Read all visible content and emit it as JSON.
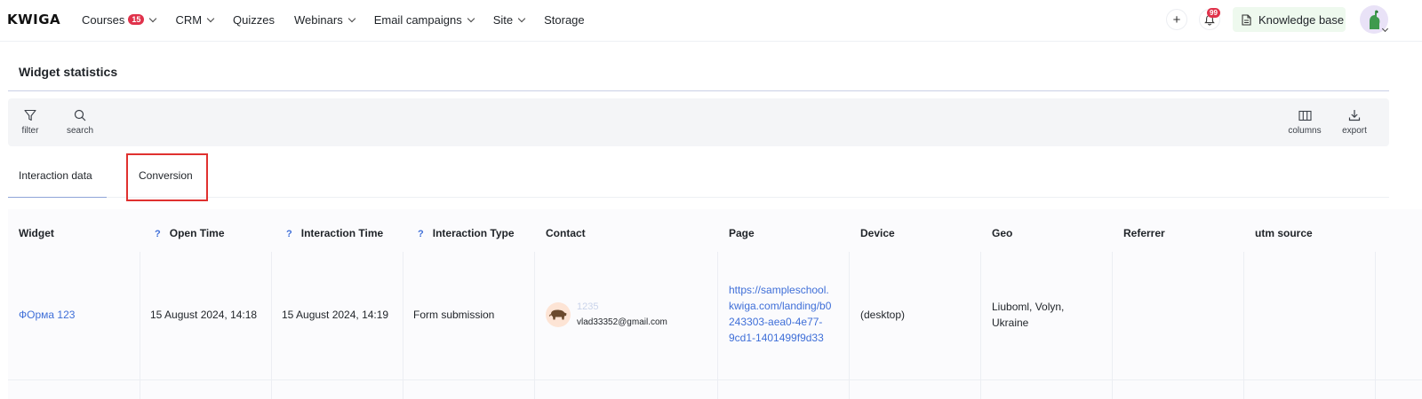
{
  "app": {
    "logo": "KWIGA"
  },
  "nav": {
    "items": [
      {
        "label": "Courses",
        "badge": "15",
        "has_dropdown": true
      },
      {
        "label": "CRM",
        "has_dropdown": true
      },
      {
        "label": "Quizzes",
        "has_dropdown": false
      },
      {
        "label": "Webinars",
        "has_dropdown": true
      },
      {
        "label": "Email campaigns",
        "has_dropdown": true
      },
      {
        "label": "Site",
        "has_dropdown": true
      },
      {
        "label": "Storage",
        "has_dropdown": false
      }
    ],
    "plus_label": "+",
    "notifications_count": "99",
    "knowledge_base_label": "Knowledge base"
  },
  "page": {
    "title": "Widget statistics"
  },
  "toolbar": {
    "filter_label": "filter",
    "search_label": "search",
    "columns_label": "columns",
    "export_label": "export"
  },
  "tabs": [
    {
      "label": "Interaction data",
      "active": true
    },
    {
      "label": "Conversion",
      "active": false
    }
  ],
  "table": {
    "columns": [
      {
        "label": "Widget",
        "help": false
      },
      {
        "label": "Open Time",
        "help": true
      },
      {
        "label": "Interaction Time",
        "help": true
      },
      {
        "label": "Interaction Type",
        "help": true
      },
      {
        "label": "Contact",
        "help": false
      },
      {
        "label": "Page",
        "help": false
      },
      {
        "label": "Device",
        "help": false
      },
      {
        "label": "Geo",
        "help": false
      },
      {
        "label": "Referrer",
        "help": false
      },
      {
        "label": "utm source",
        "help": false
      }
    ],
    "help_mark": "?",
    "rows": [
      {
        "widget": "ФОрма 123",
        "open_time": "15 August 2024, 14:18",
        "interaction_time": "15 August 2024, 14:19",
        "interaction_type": "Form submission",
        "contact_name": "1235",
        "contact_email": "vlad33352@gmail.com",
        "page_lines": [
          "https://sampleschool.",
          "kwiga.com/landing/b0",
          "243303-aea0-4e77-",
          "9cd1-1401499f9d33"
        ],
        "device": "(desktop)",
        "geo_lines": [
          "Liuboml, Volyn,",
          "Ukraine"
        ],
        "referrer": "",
        "utm_source": ""
      }
    ]
  },
  "colors": {
    "accent": "#3f6fd8",
    "badge": "#e0324b",
    "highlight": "#e0312f",
    "knowledge_bg": "#eef9ee"
  }
}
